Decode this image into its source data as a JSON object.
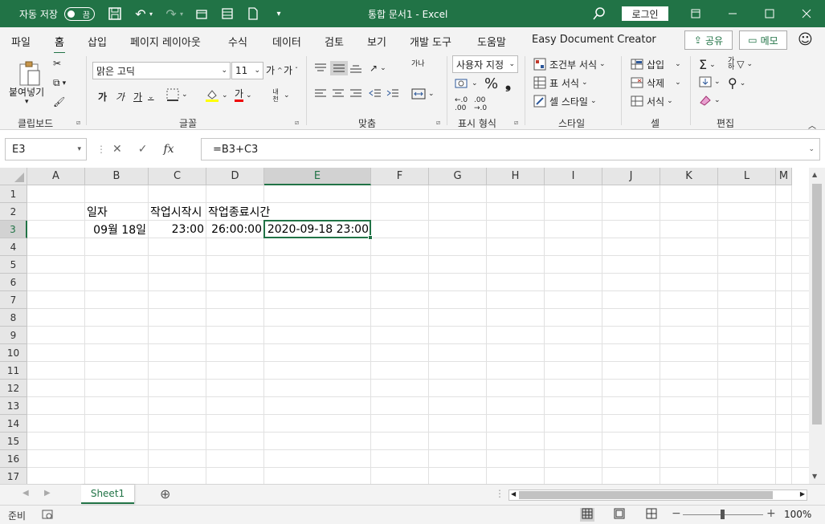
{
  "titlebar": {
    "autosave_label": "자동 저장",
    "autosave_state": "끔",
    "doc_title": "통합 문서1  -  Excel",
    "login_label": "로그인"
  },
  "tabs": [
    "파일",
    "홈",
    "삽입",
    "페이지 레이아웃",
    "수식",
    "데이터",
    "검토",
    "보기",
    "개발 도구",
    "도움말",
    "Easy Document Creator"
  ],
  "active_tab": "홈",
  "share_label": "공유",
  "memo_label": "메모",
  "ribbon": {
    "clipboard": {
      "paste_label": "붙여넣기",
      "group_label": "클립보드"
    },
    "font": {
      "font_name": "맑은 고딕",
      "font_size": "11",
      "group_label": "글꼴",
      "bold": "가",
      "italic": "가",
      "underline": "가",
      "grow": "가",
      "shrink": "가",
      "color_a": "가",
      "phonetic": "내천"
    },
    "align": {
      "group_label": "맞춤",
      "wrap": "가나"
    },
    "number": {
      "format": "사용자 지정",
      "group_label": "표시 형식"
    },
    "styles": {
      "cond": "조건부 서식",
      "table": "표 서식",
      "cell": "셀 스타일",
      "group_label": "스타일"
    },
    "cells": {
      "insert": "삽입",
      "delete": "삭제",
      "format": "서식",
      "group_label": "셀"
    },
    "edit": {
      "group_label": "편집"
    }
  },
  "formula": {
    "namebox": "E3",
    "formula": "=B3+C3",
    "fx": "fx"
  },
  "columns": [
    "A",
    "B",
    "C",
    "D",
    "E",
    "F",
    "G",
    "H",
    "I",
    "J",
    "K",
    "L",
    "M"
  ],
  "rows": [
    "1",
    "2",
    "3",
    "4",
    "5",
    "6",
    "7",
    "8",
    "9",
    "10",
    "11",
    "12",
    "13",
    "14",
    "15",
    "16",
    "17"
  ],
  "cells": {
    "B2": "일자",
    "C2": "작업시작시",
    "D2": "작업종료시간",
    "B3": "09월 18일",
    "C3": "23:00",
    "D3": "26:00:00",
    "E3": "2020-09-18 23:00"
  },
  "sheet": {
    "name": "Sheet1"
  },
  "status": {
    "ready": "준비",
    "zoom": "100%"
  }
}
